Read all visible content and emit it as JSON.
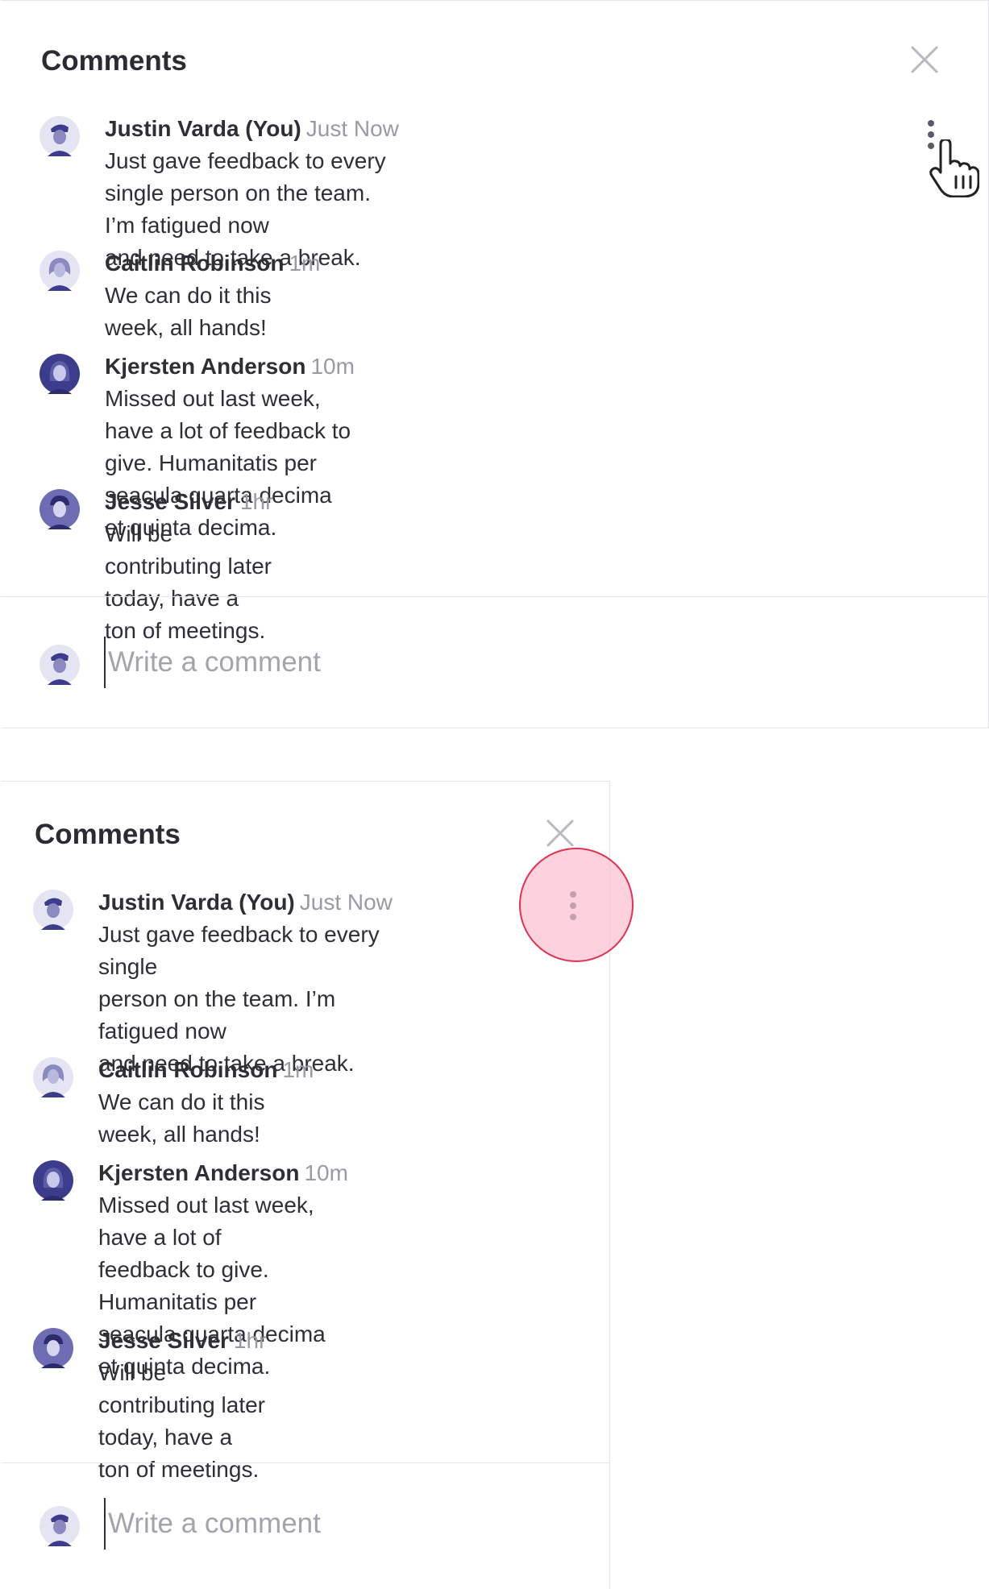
{
  "panels": [
    {
      "title": "Comments",
      "comments": [
        {
          "author": "Justin Varda (You)",
          "time": "Just Now",
          "lines": [
            "Just gave feedback to every single person on the team. I’m fatigued now",
            "and need to take a break."
          ]
        },
        {
          "author": "Caitlin Robinson",
          "time": "1m",
          "lines": [
            "We can do it this week, all hands!"
          ]
        },
        {
          "author": "Kjersten Anderson",
          "time": "10m",
          "lines": [
            "Missed out last week, have a lot of feedback to give. Humanitatis per",
            "seacula quarta decima et quinta decima."
          ]
        },
        {
          "author": "Jesse Silver",
          "time": "1hr",
          "lines": [
            "Will be contributing later today, have a ton of meetings."
          ]
        }
      ],
      "composer": {
        "placeholder": "Write a comment"
      }
    },
    {
      "title": "Comments",
      "comments": [
        {
          "author": "Justin Varda (You)",
          "time": "Just Now",
          "lines": [
            "Just gave feedback to every single",
            "person on the team. I’m fatigued now",
            "and need to take a break."
          ]
        },
        {
          "author": "Caitlin Robinson",
          "time": "1m",
          "lines": [
            "We can do it this week, all hands!"
          ]
        },
        {
          "author": "Kjersten Anderson",
          "time": "10m",
          "lines": [
            "Missed out last week, have a lot of",
            "feedback to give. Humanitatis per",
            "seacula quarta decima et quinta decima."
          ]
        },
        {
          "author": "Jesse Silver",
          "time": "1hr",
          "lines": [
            "Will be contributing later today, have a",
            "ton of meetings."
          ]
        }
      ],
      "composer": {
        "placeholder": "Write a comment"
      }
    }
  ],
  "icons": {
    "close": "close-icon",
    "menu": "more-vertical-icon",
    "cursor": "hand-pointer-cursor-icon",
    "avatars": [
      "avatar-justin-varda",
      "avatar-caitlin-robinson",
      "avatar-kjersten-anderson",
      "avatar-jesse-silver"
    ]
  },
  "colors": {
    "avatar_tint": "#3d3c8c",
    "avatar_bg": "#e4e4f2",
    "muted_text": "#9a9aa6",
    "highlight_fill": "#fcbece",
    "highlight_stroke": "#e03352"
  }
}
